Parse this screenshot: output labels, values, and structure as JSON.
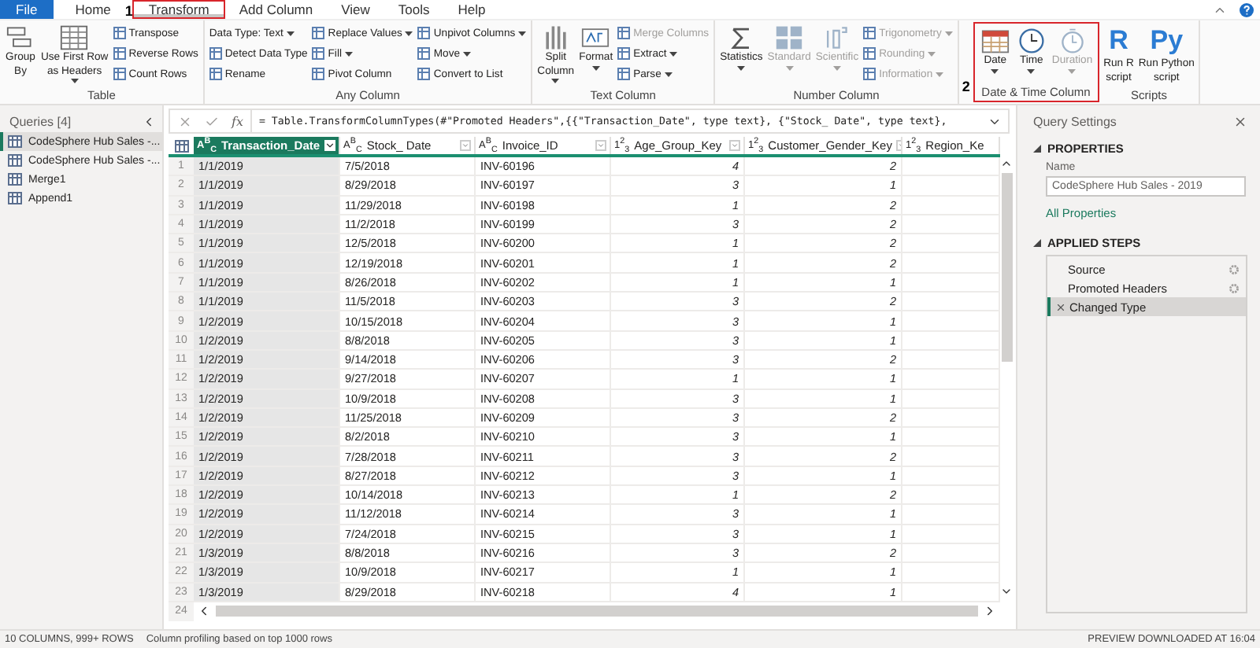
{
  "tabs": [
    {
      "label": "File",
      "kind": "file",
      "selected": false
    },
    {
      "label": "Home",
      "kind": "plain",
      "selected": false
    },
    {
      "label": "Transform",
      "kind": "plain",
      "selected": true,
      "marker": "1",
      "outlined": true
    },
    {
      "label": "Add Column",
      "kind": "plain",
      "selected": false
    },
    {
      "label": "View",
      "kind": "plain",
      "selected": false
    },
    {
      "label": "Tools",
      "kind": "plain",
      "selected": false
    },
    {
      "label": "Help",
      "kind": "plain",
      "selected": false
    }
  ],
  "ribbon": [
    {
      "label": "Table",
      "columns": [
        [
          {
            "kind": "large",
            "lines": [
              "Group",
              "By"
            ]
          }
        ],
        [
          {
            "kind": "large",
            "lines": [
              "Use First Row",
              "as Headers"
            ],
            "dropdown": true
          }
        ],
        [
          {
            "kind": "small",
            "label": "Transpose"
          },
          {
            "kind": "small",
            "label": "Reverse Rows"
          },
          {
            "kind": "small",
            "label": "Count Rows"
          }
        ]
      ]
    },
    {
      "label": "Any Column",
      "columns": [
        [
          {
            "kind": "small",
            "label": "Data Type: Text",
            "dropdown": true,
            "no_icon": true
          },
          {
            "kind": "small",
            "label": "Detect Data Type"
          },
          {
            "kind": "small",
            "label": "Rename"
          }
        ],
        [
          {
            "kind": "small",
            "label": "Replace Values",
            "dropdown": true
          },
          {
            "kind": "small",
            "label": "Fill",
            "dropdown": true
          },
          {
            "kind": "small",
            "label": "Pivot Column"
          }
        ],
        [
          {
            "kind": "small",
            "label": "Unpivot Columns",
            "dropdown": true
          },
          {
            "kind": "small",
            "label": "Move",
            "dropdown": true
          },
          {
            "kind": "small",
            "label": "Convert to List"
          }
        ]
      ]
    },
    {
      "label": "Text Column",
      "columns": [
        [
          {
            "kind": "large",
            "lines": [
              "Split",
              "Column"
            ],
            "dropdown": true
          }
        ],
        [
          {
            "kind": "large",
            "lines": [
              "Format"
            ],
            "dropdown": true
          }
        ],
        [
          {
            "kind": "small",
            "label": "Merge Columns",
            "disabled": true
          },
          {
            "kind": "small",
            "label": "Extract",
            "dropdown": true
          },
          {
            "kind": "small",
            "label": "Parse",
            "dropdown": true
          }
        ]
      ]
    },
    {
      "label": "Number Column",
      "columns": [
        [
          {
            "kind": "large",
            "lines": [
              "Statistics"
            ],
            "dropdown": true
          }
        ],
        [
          {
            "kind": "large",
            "lines": [
              "Standard"
            ],
            "dropdown": true,
            "disabled": true
          }
        ],
        [
          {
            "kind": "large",
            "lines": [
              "Scientific"
            ],
            "dropdown": true,
            "disabled": true
          }
        ],
        [
          {
            "kind": "small",
            "label": "Trigonometry",
            "dropdown": true,
            "disabled": true
          },
          {
            "kind": "small",
            "label": "Rounding",
            "dropdown": true,
            "disabled": true
          },
          {
            "kind": "small",
            "label": "Information",
            "dropdown": true,
            "disabled": true
          }
        ]
      ]
    },
    {
      "label": "Date & Time Column",
      "marker": "2",
      "outlined": true,
      "columns": [
        [
          {
            "kind": "large",
            "lines": [
              "Date"
            ],
            "dropdown": true
          }
        ],
        [
          {
            "kind": "large",
            "lines": [
              "Time"
            ],
            "dropdown": true
          }
        ],
        [
          {
            "kind": "large",
            "lines": [
              "Duration"
            ],
            "dropdown": true,
            "disabled": true
          }
        ]
      ]
    },
    {
      "label": "Scripts",
      "columns": [
        [
          {
            "kind": "logo",
            "logo": "R",
            "lines": [
              "Run R",
              "script"
            ]
          }
        ],
        [
          {
            "kind": "logo",
            "logo": "Py",
            "lines": [
              "Run Python",
              "script"
            ]
          }
        ]
      ]
    }
  ],
  "queries": {
    "title": "Queries [4]",
    "items": [
      {
        "label": "CodeSphere Hub Sales -...",
        "selected": true
      },
      {
        "label": "CodeSphere Hub Sales -...",
        "selected": false
      },
      {
        "label": "Merge1",
        "selected": false
      },
      {
        "label": "Append1",
        "selected": false
      }
    ]
  },
  "formula_bar": {
    "function_label": "fx",
    "formula": "= Table.TransformColumnTypes(#\"Promoted Headers\",{{\"Transaction_Date\", type text}, {\"Stock_ Date\", type text},"
  },
  "table": {
    "columns": [
      {
        "name": "Transaction_Date",
        "type": "A$^{B}$$_{C}$",
        "kind": "text",
        "selected": true
      },
      {
        "name": "Stock_ Date",
        "type": "A$^{B}$$_{C}$",
        "kind": "text",
        "selected": false
      },
      {
        "name": "Invoice_ID",
        "type": "A$^{B}$$_{C}$",
        "kind": "text",
        "selected": false
      },
      {
        "name": "Age_Group_Key",
        "type": "1$^{2}$$_{3}$",
        "kind": "number",
        "selected": false
      },
      {
        "name": "Customer_Gender_Key",
        "type": "1$^{2}$$_{3}$",
        "kind": "number",
        "selected": false
      },
      {
        "name": "Region_Ke",
        "type": "1$^{2}$$_{3}$",
        "kind": "number",
        "selected": false
      }
    ],
    "rows": [
      {
        "n": "1",
        "cells": [
          "1/1/2019",
          "7/5/2018",
          "INV-60196",
          "4",
          "2"
        ]
      },
      {
        "n": "2",
        "cells": [
          "1/1/2019",
          "8/29/2018",
          "INV-60197",
          "3",
          "1"
        ]
      },
      {
        "n": "3",
        "cells": [
          "1/1/2019",
          "11/29/2018",
          "INV-60198",
          "1",
          "2"
        ]
      },
      {
        "n": "4",
        "cells": [
          "1/1/2019",
          "11/2/2018",
          "INV-60199",
          "3",
          "2"
        ]
      },
      {
        "n": "5",
        "cells": [
          "1/1/2019",
          "12/5/2018",
          "INV-60200",
          "1",
          "2"
        ]
      },
      {
        "n": "6",
        "cells": [
          "1/1/2019",
          "12/19/2018",
          "INV-60201",
          "1",
          "2"
        ]
      },
      {
        "n": "7",
        "cells": [
          "1/1/2019",
          "8/26/2018",
          "INV-60202",
          "1",
          "1"
        ]
      },
      {
        "n": "8",
        "cells": [
          "1/1/2019",
          "11/5/2018",
          "INV-60203",
          "3",
          "2"
        ]
      },
      {
        "n": "9",
        "cells": [
          "1/2/2019",
          "10/15/2018",
          "INV-60204",
          "3",
          "1"
        ]
      },
      {
        "n": "10",
        "cells": [
          "1/2/2019",
          "8/8/2018",
          "INV-60205",
          "3",
          "1"
        ]
      },
      {
        "n": "11",
        "cells": [
          "1/2/2019",
          "9/14/2018",
          "INV-60206",
          "3",
          "2"
        ]
      },
      {
        "n": "12",
        "cells": [
          "1/2/2019",
          "9/27/2018",
          "INV-60207",
          "1",
          "1"
        ]
      },
      {
        "n": "13",
        "cells": [
          "1/2/2019",
          "10/9/2018",
          "INV-60208",
          "3",
          "1"
        ]
      },
      {
        "n": "14",
        "cells": [
          "1/2/2019",
          "11/25/2018",
          "INV-60209",
          "3",
          "2"
        ]
      },
      {
        "n": "15",
        "cells": [
          "1/2/2019",
          "8/2/2018",
          "INV-60210",
          "3",
          "1"
        ]
      },
      {
        "n": "16",
        "cells": [
          "1/2/2019",
          "7/28/2018",
          "INV-60211",
          "3",
          "2"
        ]
      },
      {
        "n": "17",
        "cells": [
          "1/2/2019",
          "8/27/2018",
          "INV-60212",
          "3",
          "1"
        ]
      },
      {
        "n": "18",
        "cells": [
          "1/2/2019",
          "10/14/2018",
          "INV-60213",
          "1",
          "2"
        ]
      },
      {
        "n": "19",
        "cells": [
          "1/2/2019",
          "11/12/2018",
          "INV-60214",
          "3",
          "1"
        ]
      },
      {
        "n": "20",
        "cells": [
          "1/2/2019",
          "7/24/2018",
          "INV-60215",
          "3",
          "1"
        ]
      },
      {
        "n": "21",
        "cells": [
          "1/3/2019",
          "8/8/2018",
          "INV-60216",
          "3",
          "2"
        ]
      },
      {
        "n": "22",
        "cells": [
          "1/3/2019",
          "10/9/2018",
          "INV-60217",
          "1",
          "1"
        ]
      },
      {
        "n": "23",
        "cells": [
          "1/3/2019",
          "8/29/2018",
          "INV-60218",
          "4",
          "1"
        ]
      }
    ],
    "last_row_number": "24"
  },
  "settings": {
    "title": "Query Settings",
    "properties_heading": "PROPERTIES",
    "name_label": "Name",
    "name_value": "CodeSphere Hub Sales - 2019",
    "all_properties": "All Properties",
    "steps_heading": "APPLIED STEPS",
    "steps": [
      {
        "label": "Source",
        "selected": false,
        "has_settings": true
      },
      {
        "label": "Promoted Headers",
        "selected": false,
        "has_settings": true
      },
      {
        "label": "Changed Type",
        "selected": true,
        "has_settings": false
      }
    ]
  },
  "status_bar": {
    "columns_rows": "10 COLUMNS, 999+ ROWS",
    "profiling": "Column profiling based on top 1000 rows",
    "preview": "PREVIEW DOWNLOADED AT 16:04"
  }
}
